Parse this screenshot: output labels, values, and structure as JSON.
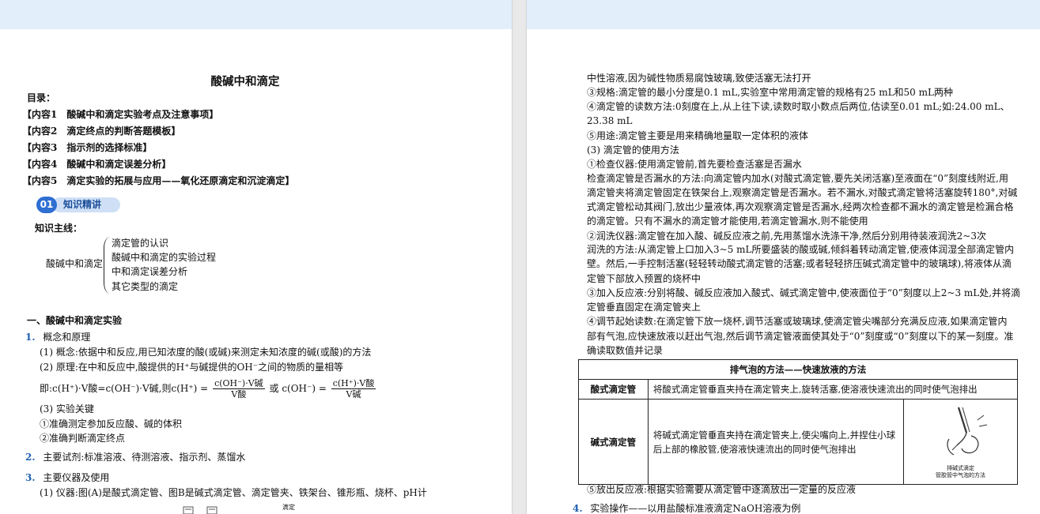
{
  "left": {
    "title": "酸碱中和滴定",
    "toc_label": "目录：",
    "toc": [
      "【内容1　酸碱中和滴定实验考点及注意事项】",
      "【内容2　滴定终点的判断答题模板】",
      "【内容3　指示剂的选择标准】",
      "【内容4　酸碱中和滴定误差分析】",
      "【内容5　滴定实验的拓展与应用——氧化还原滴定和沉淀滴定】"
    ],
    "badge_num": "01",
    "badge_label": "知识精讲",
    "mainline_label": "知识主线：",
    "tree_root": "酸碱中和滴定",
    "tree_items": [
      "滴定管的认识",
      "酸碱中和滴定的实验过程",
      "中和滴定误差分析",
      "其它类型的滴定"
    ],
    "section1": "一、酸碱中和滴定实验",
    "item1_num": "1.",
    "item1_title": "概念和原理",
    "concept": "(1) 概念:依据中和反应,用已知浓度的酸(或碱)来测定未知浓度的碱(或酸)的方法",
    "principle": "(2) 原理:在中和反应中,酸提供的H⁺与碱提供的OH⁻之间的物质的量相等",
    "formula_prefix": "即:c(H⁺)·V酸=c(OH⁻)·V碱,则c(H⁺) =",
    "formula_num1": "c(OH⁻)·V碱",
    "formula_den1": "V酸",
    "formula_or": "或 c(OH⁻) =",
    "formula_num2": "c(H⁺)·V酸",
    "formula_den2": "V碱",
    "key_title": "(3) 实验关键",
    "key1": "①准确测定参加反应酸、碱的体积",
    "key2": "②准确判断滴定终点",
    "item2_num": "2.",
    "item2_text": "主要试剂:标准溶液、待测溶液、指示剂、蒸馏水",
    "item3_num": "3.",
    "item3_title": "主要仪器及使用",
    "instrument": "(1) 仪器:图(A)是酸式滴定管、图B是碱式滴定管、滴定管夹、铁架台、锥形瓶、烧杯、pH计",
    "fig_fragment": "滴定"
  },
  "right": {
    "lines": [
      "中性溶液,因为碱性物质易腐蚀玻璃,致使活塞无法打开",
      "③规格:滴定管的最小分度是0.1 mL,实验室中常用滴定管的规格有25 mL和50 mL两种",
      "④滴定管的读数方法:0刻度在上,从上往下读,读数时取小数点后两位,估读至0.01 mL;如:24.00 mL、",
      "23.38 mL",
      "⑤用途:滴定管主要是用来精确地量取一定体积的液体",
      "(3) 滴定管的使用方法",
      "①检查仪器:使用滴定管前,首先要检查活塞是否漏水",
      "检查滴定管是否漏水的方法:向滴定管内加水(对酸式滴定管,要先关闭活塞)至液面在“0”刻度线附近,用",
      "滴定管夹将滴定管固定在铁架台上,观察滴定管是否漏水。若不漏水,对酸式滴定管将活塞旋转180°,对碱",
      "式滴定管松动其阀门,放出少量液体,再次观察滴定管是否漏水,经两次检查都不漏水的滴定管是检漏合格",
      "的滴定管。只有不漏水的滴定管才能使用,若滴定管漏水,则不能使用",
      "②润洗仪器:滴定管在加入酸、碱反应液之前,先用蒸馏水洗涤干净,然后分别用待装液润洗2~3次",
      "润洗的方法:从滴定管上口加入3~5 mL所要盛装的酸或碱,倾斜着转动滴定管,使液体润湿全部滴定管内",
      "壁。然后,一手控制活塞(轻轻转动酸式滴定管的活塞;或者轻轻挤压碱式滴定管中的玻璃球),将液体从滴",
      "定管下部放入预置的烧杯中",
      "③加入反应液:分别将酸、碱反应液加入酸式、碱式滴定管中,使液面位于“0”刻度以上2~3 mL处,并将滴",
      "定管垂直固定在滴定管夹上",
      "④调节起始读数:在滴定管下放一烧杯,调节活塞或玻璃球,使滴定管尖嘴部分充满反应液,如果滴定管内",
      "部有气泡,应快速放液以赶出气泡,然后调节滴定管液面使其处于“0”刻度或“0”刻度以下的某一刻度。准",
      "确读取数值并记录"
    ],
    "table": {
      "header": "排气泡的方法——快速放液的方法",
      "row1_label": "酸式滴定管",
      "row1_text": "将酸式滴定管垂直夹持在滴定管夹上,旋转活塞,使溶液快速流出的同时使气泡排出",
      "row2_label": "碱式滴定管",
      "row2_text": "将碱式滴定管垂直夹持在滴定管夹上,使尖嘴向上,并捏住小球后上部的橡胶管,使溶液快速流出的同时使气泡排出",
      "fig_caption1": "排碱式滴定",
      "fig_caption2": "管胶管中气泡的方法"
    },
    "release": "⑤放出反应液:根据实验需要从滴定管中逐滴放出一定量的反应液",
    "item4_num": "4.",
    "item4_text": "实验操作——以用盐酸标准液滴定NaOH溶液为例"
  }
}
